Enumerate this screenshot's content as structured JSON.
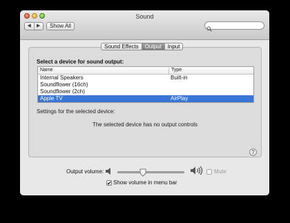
{
  "window": {
    "title": "Sound"
  },
  "toolbar": {
    "back_glyph": "◀",
    "forward_glyph": "▶",
    "show_all_label": "Show All",
    "search_placeholder": ""
  },
  "tabs": [
    {
      "label": "Sound Effects",
      "active": false
    },
    {
      "label": "Output",
      "active": true
    },
    {
      "label": "Input",
      "active": false
    }
  ],
  "output": {
    "select_label": "Select a device for sound output:",
    "columns": {
      "name": "Name",
      "type": "Type"
    },
    "devices": [
      {
        "name": "Internal Speakers",
        "type": "Built-in",
        "selected": false
      },
      {
        "name": "Soundflower (16ch)",
        "type": "",
        "selected": false
      },
      {
        "name": "Soundflower (2ch)",
        "type": "",
        "selected": false
      },
      {
        "name": "Apple TV",
        "type": "AirPlay",
        "selected": true
      }
    ],
    "settings_label": "Settings for the selected device:",
    "no_controls_message": "The selected device has no output controls",
    "help_glyph": "?"
  },
  "volume": {
    "label": "Output volume:",
    "level": 0.38,
    "mute_label": "Mute",
    "mute_checked": false,
    "mute_enabled": false,
    "show_in_menu_bar_label": "Show volume in menu bar",
    "show_in_menu_bar_checked": true,
    "check_glyph": "✔"
  },
  "colors": {
    "selection": "#3875d7",
    "window_bg": "#e8e8e8"
  }
}
